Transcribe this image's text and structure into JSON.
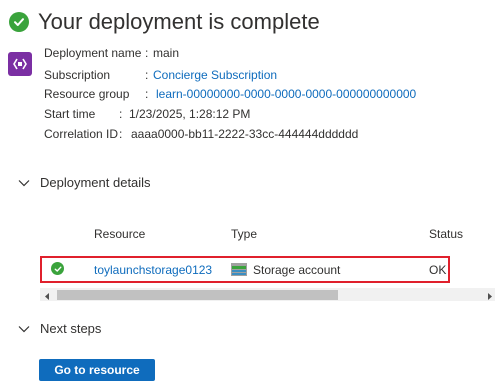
{
  "header": {
    "title": "Your deployment is complete"
  },
  "details": {
    "rows": [
      {
        "label": "Deployment name",
        "value": "main",
        "is_link": false
      },
      {
        "label": "Subscription",
        "value": "Concierge Subscription",
        "is_link": true
      },
      {
        "label": "Resource group",
        "value": "learn-00000000-0000-0000-0000-000000000000",
        "is_link": true
      },
      {
        "label": "Start time",
        "value": "1/23/2025, 1:28:12 PM",
        "is_link": false
      },
      {
        "label": "Correlation ID",
        "value": "aaaa0000-bb11-2222-33cc-444444dddddd",
        "is_link": false
      }
    ],
    "separator": ":"
  },
  "deployment_details": {
    "title": "Deployment details",
    "columns": [
      "Resource",
      "Type",
      "Status"
    ],
    "rows": [
      {
        "resource": "toylaunchstorage0123",
        "type": "Storage account",
        "status": "OK",
        "status_icon": "check-circle-icon",
        "type_icon": "storage-account-icon"
      }
    ]
  },
  "next_steps": {
    "title": "Next steps",
    "button_label": "Go to resource"
  },
  "colors": {
    "success": "#3aa33c",
    "link": "#0f6cbd",
    "highlight": "#e0202c",
    "deploy_icon": "#7b2fa3"
  }
}
